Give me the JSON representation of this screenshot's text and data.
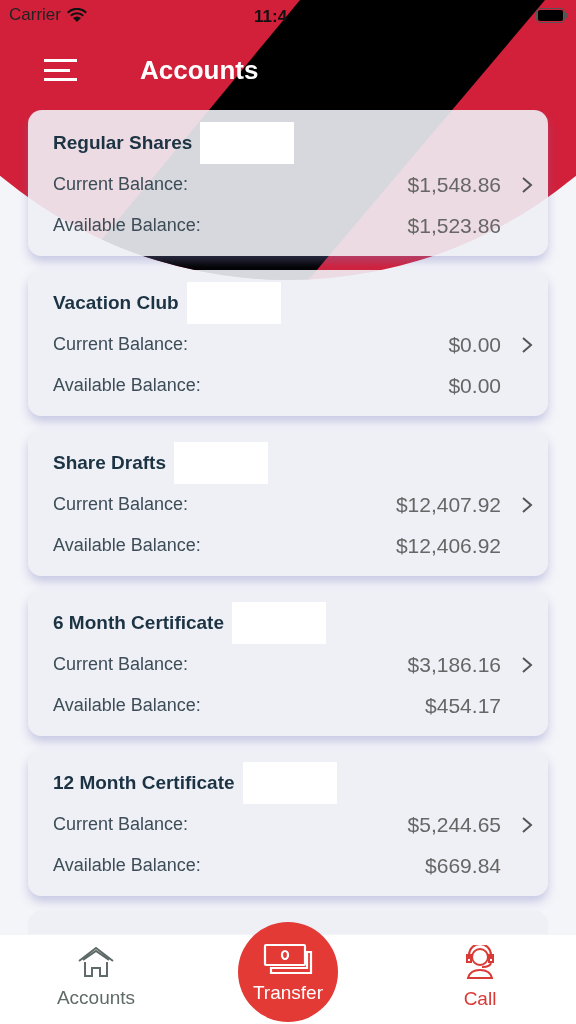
{
  "status_bar": {
    "carrier": "Carrier",
    "time": "11:4"
  },
  "header": {
    "title": "Accounts"
  },
  "accounts": [
    {
      "name": "Regular Shares",
      "current_label": "Current Balance:",
      "current": "$1,548.86",
      "available_label": "Available Balance:",
      "available": "$1,523.86"
    },
    {
      "name": "Vacation Club",
      "current_label": "Current Balance:",
      "current": "$0.00",
      "available_label": "Available Balance:",
      "available": "$0.00"
    },
    {
      "name": "Share Drafts",
      "current_label": "Current Balance:",
      "current": "$12,407.92",
      "available_label": "Available Balance:",
      "available": "$12,406.92"
    },
    {
      "name": "6 Month Certificate",
      "current_label": "Current Balance:",
      "current": "$3,186.16",
      "available_label": "Available Balance:",
      "available": "$454.17"
    },
    {
      "name": "12 Month Certificate",
      "current_label": "Current Balance:",
      "current": "$5,244.65",
      "available_label": "Available Balance:",
      "available": "$669.84"
    }
  ],
  "tab_bar": [
    {
      "kind": "home",
      "label": "Accounts"
    },
    {
      "kind": "transfer",
      "label": "Transfer"
    },
    {
      "kind": "call",
      "label": "Call"
    }
  ]
}
